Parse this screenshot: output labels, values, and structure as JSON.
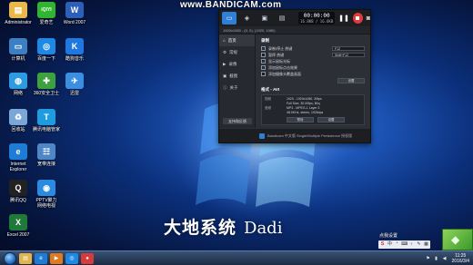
{
  "watermark": "www.BANDICAM.com",
  "desktop_icons": [
    {
      "label": "Administrator",
      "icon": "user-folder-icon",
      "color": "#e8b84a",
      "glyph": "▤"
    },
    {
      "label": "爱奇艺",
      "icon": "iqiyi-icon",
      "color": "#2fb52f",
      "glyph": "iQIYI"
    },
    {
      "label": "Word 2007",
      "icon": "word-icon",
      "color": "#2b5fb8",
      "glyph": "W"
    },
    {
      "label": "计算机",
      "icon": "computer-icon",
      "color": "#3c7fc2",
      "glyph": "▭"
    },
    {
      "label": "百度一下",
      "icon": "browser-icon",
      "color": "#1e88e5",
      "glyph": "◎"
    },
    {
      "label": "酷狗音乐",
      "icon": "kugou-icon",
      "color": "#1e78e0",
      "glyph": "K"
    },
    {
      "label": "网络",
      "icon": "network-icon",
      "color": "#2d9be0",
      "glyph": "◍"
    },
    {
      "label": "360安全卫士",
      "icon": "shield-icon",
      "color": "#3da13d",
      "glyph": "✚"
    },
    {
      "label": "迅雷",
      "icon": "bird-icon",
      "color": "#3b8fe0",
      "glyph": "✈"
    },
    {
      "label": "回收站",
      "icon": "recycle-bin-icon",
      "color": "#7aa7d8",
      "glyph": "♻"
    },
    {
      "label": "腾讯电脑管家",
      "icon": "tencent-guard-icon",
      "color": "#1f9be0",
      "glyph": "T"
    },
    {
      "label": "Internet\nExplorer",
      "icon": "ie-icon",
      "color": "#1e7bd6",
      "glyph": "e"
    },
    {
      "label": "宽带连接",
      "icon": "broadband-icon",
      "color": "#4f87c6",
      "glyph": "☷"
    },
    {
      "label": "腾讯QQ",
      "icon": "qq-icon",
      "color": "#222222",
      "glyph": "Q"
    },
    {
      "label": "PPTV聚力\n网络电视",
      "icon": "pptv-icon",
      "color": "#2a8be0",
      "glyph": "◉"
    },
    {
      "label": "Excel 2007",
      "icon": "excel-icon",
      "color": "#1f7a3a",
      "glyph": "X"
    }
  ],
  "bandicam": {
    "modes": [
      "rect-mode-icon",
      "game-mode-icon",
      "device-mode-icon",
      "screen-mode-icon"
    ],
    "timer": "00:00:00",
    "size": "16.8KB / 16.6KB",
    "resolution": "1920x1080 - (0, 0), (1920, 1080)",
    "nav": [
      "首页",
      "常规",
      "录像",
      "截图",
      "关于"
    ],
    "side_button": "支持和反馈",
    "record_section": "录制",
    "rows": [
      {
        "label": "录制/停止 热键",
        "checked": true,
        "hotkey": "F12"
      },
      {
        "label": "暂停 热键",
        "checked": false,
        "hotkey": "Shift+F12"
      },
      {
        "label": "显示鼠标光标",
        "checked": true,
        "hotkey": ""
      },
      {
        "label": "添加鼠标点击效果",
        "checked": true,
        "hotkey": ""
      },
      {
        "label": "添加摄像头覆盖画面",
        "checked": false,
        "hotkey": ""
      }
    ],
    "settings_label": "设置",
    "format_section": "格式 - AVI",
    "format": {
      "video_key": "视频",
      "video_val": "1920 - 1920x1080, 30fps\nFull Size, 30.00fps, 80q",
      "audio_key": "音频",
      "audio_val": "MP3 - MPEG-1 Layer 3\n48.0KHz, stereo, 192kbps"
    },
    "preset_label": "预设",
    "format_settings_label": "设置",
    "footer": "Bandicam 中文版 Single/Multiple Persistence 授权版"
  },
  "brand": {
    "cn": "大地系统",
    "en": "Dadi"
  },
  "ime_tip": "点我设置",
  "ime_buttons": [
    "S",
    "中",
    "ᐤ",
    "⌨",
    "♀",
    "✎",
    "▦"
  ],
  "taskbar": {
    "apps": [
      {
        "icon": "explorer-icon",
        "color": "#e2b44c",
        "glyph": "▤"
      },
      {
        "icon": "ie-taskbar-icon",
        "color": "#1e7bd6",
        "glyph": "e"
      },
      {
        "icon": "media-player-icon",
        "color": "#e07a1e",
        "glyph": "▶"
      },
      {
        "icon": "browser2-icon",
        "color": "#1e88e5",
        "glyph": "◎"
      },
      {
        "icon": "bandicam-taskbar-icon",
        "color": "#d63a3a",
        "glyph": "●"
      }
    ],
    "time": "11:25",
    "date": "2016/3/4"
  }
}
